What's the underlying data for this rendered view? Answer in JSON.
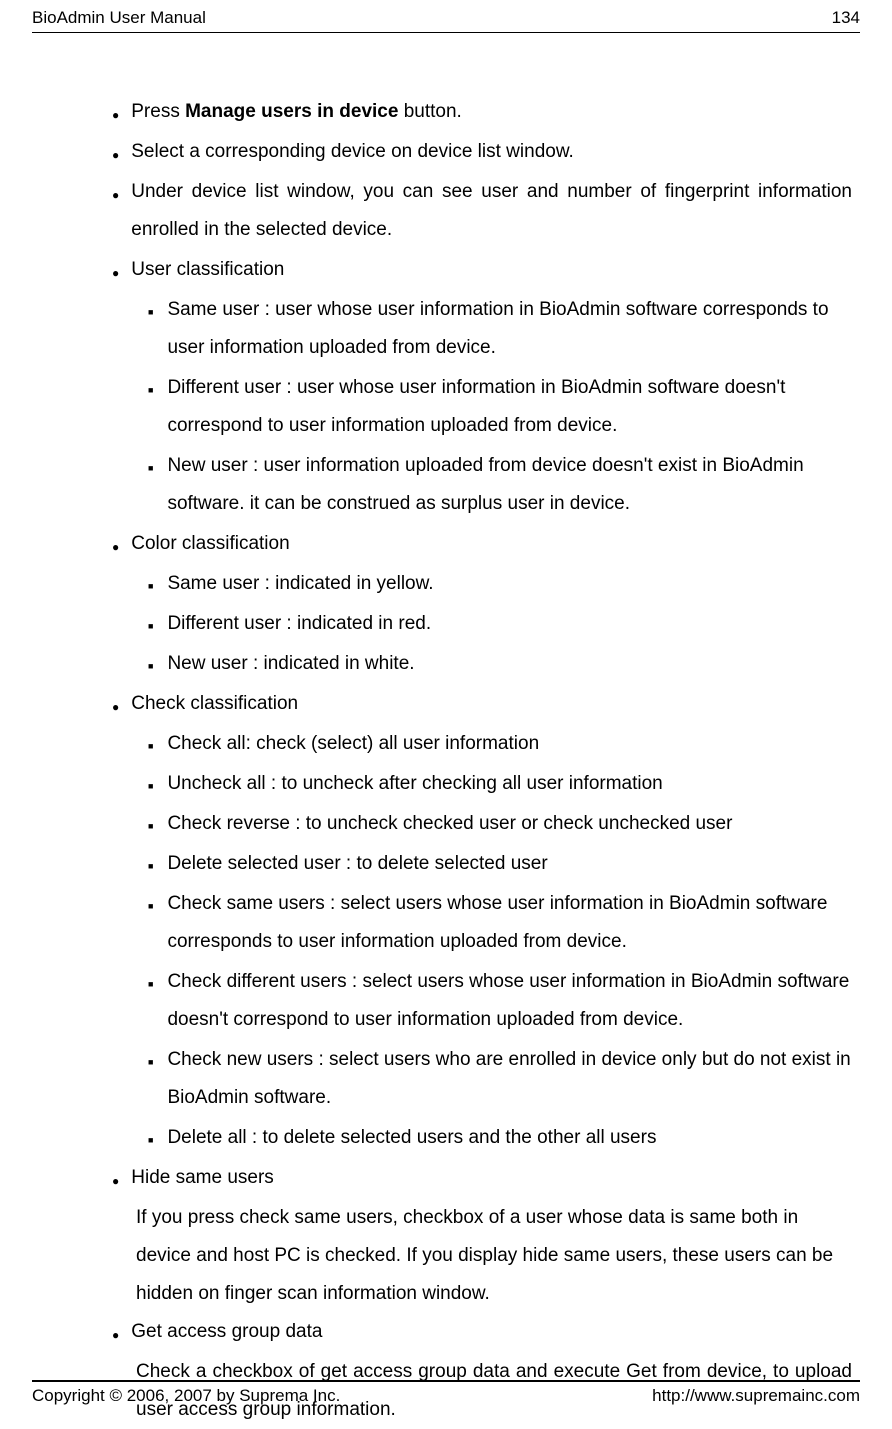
{
  "header": {
    "title": "BioAdmin User Manual",
    "pageNumber": "134"
  },
  "content": {
    "items": [
      {
        "type": "bullet",
        "parts": [
          {
            "text": "Press ",
            "bold": false
          },
          {
            "text": "Manage users in device",
            "bold": true
          },
          {
            "text": " button.",
            "bold": false
          }
        ]
      },
      {
        "type": "bullet",
        "text": "Select a corresponding device on device list window."
      },
      {
        "type": "bullet",
        "justify": true,
        "text": "Under device list window, you can see user and number of fingerprint information enrolled in the selected device."
      },
      {
        "type": "bullet",
        "text": "User classification",
        "subitems": [
          "Same user : user whose user information in BioAdmin software corresponds to user information uploaded from device.",
          "Different user : user whose user information in BioAdmin software doesn't correspond to user information uploaded from device.",
          "New user : user information uploaded from device doesn't exist in BioAdmin software. it can be construed as surplus user in device."
        ]
      },
      {
        "type": "bullet",
        "text": "Color classification",
        "subitems": [
          "Same user : indicated in yellow.",
          "Different user : indicated in red.",
          "New user : indicated in white."
        ]
      },
      {
        "type": "bullet",
        "text": "Check classification",
        "subitems": [
          "Check all: check (select) all user information",
          "Uncheck all : to uncheck after checking all user information",
          "Check reverse : to uncheck checked user or check unchecked user",
          "Delete selected user : to delete selected user",
          "Check same users : select users whose user information in BioAdmin software corresponds to user information uploaded from device.",
          "Check different users : select users whose user information in BioAdmin software doesn't correspond to user information uploaded from device.",
          "Check new users : select users who are enrolled in device only but do not exist in BioAdmin software.",
          "Delete all : to delete selected users and the other all users"
        ]
      },
      {
        "type": "bullet",
        "text": "Hide same users",
        "para": "If you press check same users, checkbox of a user whose data is same both in device and host PC is checked. If you display hide same users, these users can be hidden on finger scan information window."
      },
      {
        "type": "bullet",
        "text": "Get access group data",
        "para": "Check a checkbox of get access group data and execute Get from device, to upload user access group information.",
        "paraJustify": true
      }
    ]
  },
  "footer": {
    "copyright": "Copyright © 2006, 2007 by Suprema Inc.",
    "url": "http://www.supremainc.com"
  }
}
